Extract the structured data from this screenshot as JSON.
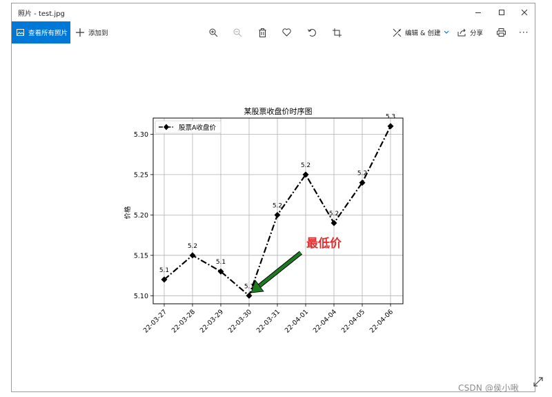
{
  "window": {
    "title": "照片 - test.jpg"
  },
  "titlebar": {
    "minimize_icon": "minimize-icon",
    "maximize_icon": "maximize-icon",
    "close_icon": "close-icon"
  },
  "toolbar": {
    "view_all_label": "查看所有照片",
    "add_to_label": "添加到",
    "icons": [
      "zoom-in-icon",
      "zoom-out-icon",
      "delete-icon",
      "favorite-icon",
      "rotate-icon",
      "crop-icon"
    ],
    "edit_create_label": "编辑 & 创建",
    "share_label": "分享",
    "print_icon": "print-icon",
    "more_label": "···"
  },
  "chart_data": {
    "type": "line",
    "title": "某股票收盘价时序图",
    "ylabel": "价格",
    "xlabel": "",
    "categories": [
      "22-03-27",
      "22-03-28",
      "22-03-29",
      "22-03-30",
      "22-03-31",
      "22-04-01",
      "22-04-04",
      "22-04-05",
      "22-04-06"
    ],
    "series": [
      {
        "name": "股票A收盘价",
        "values": [
          5.12,
          5.15,
          5.13,
          5.1,
          5.2,
          5.25,
          5.19,
          5.24,
          5.31
        ]
      }
    ],
    "data_labels": [
      "5.1",
      "5.2",
      "5.1",
      "5.1",
      "5.2",
      "5.2",
      "5.2",
      "5.2",
      "5.3"
    ],
    "yticks": [
      "5.10",
      "5.15",
      "5.20",
      "5.25",
      "5.30"
    ],
    "ylim": [
      5.09,
      5.32
    ],
    "grid": true,
    "legend": "top-left",
    "line_style": "dash-dot",
    "marker": "diamond",
    "line_color": "#000000",
    "annotation": {
      "text": "最低价",
      "target_index": 3,
      "arrow_color": "#1e7a1e",
      "text_color": "#e03030"
    }
  },
  "resize_icon": "expand-icon",
  "watermark": "CSDN @侯小啾"
}
